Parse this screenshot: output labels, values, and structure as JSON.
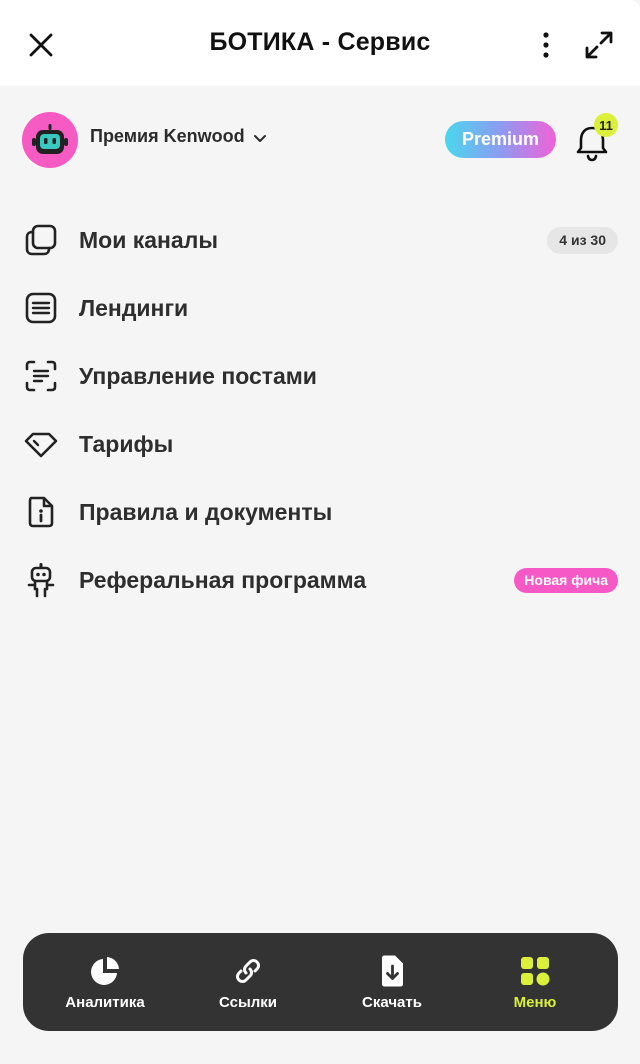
{
  "header": {
    "title": "БОТИКА - Сервис",
    "close_icon": "close-icon",
    "more_icon": "more-vertical-icon",
    "expand_icon": "expand-icon"
  },
  "profile": {
    "account_name": "Премия Kenwood",
    "premium_label": "Premium",
    "notification_count": "11"
  },
  "menu": {
    "items": [
      {
        "label": "Мои каналы",
        "icon": "channels-icon",
        "badge": "4 из 30"
      },
      {
        "label": "Лендинги",
        "icon": "landing-icon"
      },
      {
        "label": "Управление постами",
        "icon": "posts-icon"
      },
      {
        "label": "Тарифы",
        "icon": "diamond-icon"
      },
      {
        "label": "Правила и документы",
        "icon": "document-info-icon"
      },
      {
        "label": "Реферальная программа",
        "icon": "robot-icon",
        "badge": "Новая фича"
      }
    ]
  },
  "bottom_nav": {
    "items": [
      {
        "label": "Аналитика",
        "icon": "pie-chart-icon"
      },
      {
        "label": "Ссылки",
        "icon": "link-icon"
      },
      {
        "label": "Скачать",
        "icon": "download-file-icon"
      },
      {
        "label": "Меню",
        "icon": "grid-icon",
        "active": true
      }
    ]
  },
  "colors": {
    "accent_lime": "#dbf03a",
    "accent_pink": "#f659c6",
    "nav_background": "#333333",
    "page_background": "#f5f5f5"
  }
}
